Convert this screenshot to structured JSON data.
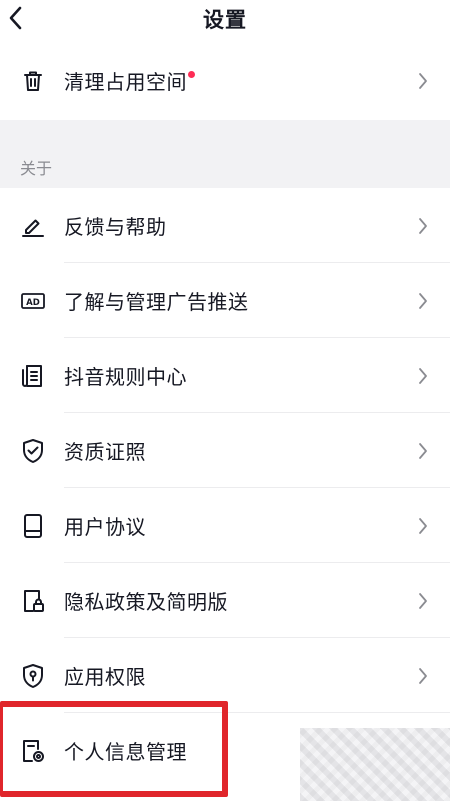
{
  "header": {
    "title": "设置",
    "back_icon": "chevron-left-icon"
  },
  "top_card": {
    "item": {
      "label": "清理占用空间",
      "icon": "trash-icon",
      "badge_color": "#fe2c55"
    }
  },
  "about_section": {
    "label": "关于",
    "items": [
      {
        "label": "反馈与帮助",
        "icon": "pencil-icon"
      },
      {
        "label": "了解与管理广告推送",
        "icon": "ad-icon"
      },
      {
        "label": "抖音规则中心",
        "icon": "document-list-icon"
      },
      {
        "label": "资质证照",
        "icon": "shield-check-icon"
      },
      {
        "label": "用户协议",
        "icon": "book-icon"
      },
      {
        "label": "隐私政策及简明版",
        "icon": "doc-lock-icon"
      },
      {
        "label": "应用权限",
        "icon": "shield-location-icon"
      },
      {
        "label": "个人信息管理",
        "icon": "doc-gear-icon"
      }
    ]
  },
  "colors": {
    "background": "#f2f2f4",
    "card": "#ffffff",
    "text": "#161823",
    "secondary_text": "#8a8b91",
    "highlight": "#e0262b"
  }
}
